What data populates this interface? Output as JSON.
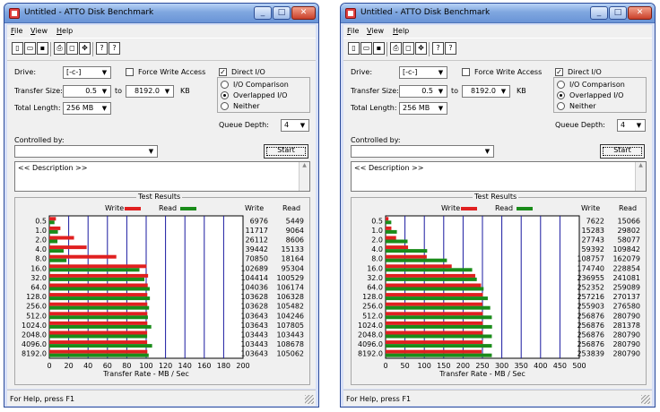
{
  "windows": [
    {
      "title": "Untitled - ATTO Disk Benchmark",
      "menu": [
        "File",
        "View",
        "Help"
      ],
      "labels": {
        "drive": "Drive:",
        "transfer_size": "Transfer Size:",
        "to": "to",
        "kb": "KB",
        "total_length": "Total Length:",
        "force_write_access": "Force Write Access",
        "direct_io": "Direct I/O",
        "io_comparison": "I/O Comparison",
        "overlapped_io": "Overlapped I/O",
        "neither": "Neither",
        "queue_depth": "Queue Depth:",
        "controlled_by": "Controlled by:",
        "start": "Start",
        "test_results": "Test Results",
        "write": "Write",
        "read": "Read",
        "x_axis_title": "Transfer Rate - MB / Sec"
      },
      "values": {
        "drive": "[-c-]",
        "transfer_from": "0.5",
        "transfer_to": "8192.0",
        "total_length": "256 MB",
        "queue_depth": "4",
        "controlled_by": "",
        "description": "<< Description >>",
        "force_write_access": false,
        "direct_io": true,
        "io_mode": "Overlapped I/O"
      },
      "status": "For Help, press F1",
      "chart_data": {
        "type": "bar",
        "categories": [
          "0.5",
          "1.0",
          "2.0",
          "4.0",
          "8.0",
          "16.0",
          "32.0",
          "64.0",
          "128.0",
          "256.0",
          "512.0",
          "1024.0",
          "2048.0",
          "4096.0",
          "8192.0"
        ],
        "series": [
          {
            "name": "Write",
            "color": "#e02020",
            "values": [
              6976,
              11717,
              26112,
              39442,
              70850,
              102689,
              104414,
              104036,
              103628,
              103628,
              103643,
              103643,
              103443,
              103443,
              103643
            ]
          },
          {
            "name": "Read",
            "color": "#1a8c1a",
            "values": [
              5449,
              9064,
              8606,
              15133,
              18164,
              95304,
              100529,
              106174,
              106328,
              105482,
              104246,
              107805,
              103443,
              108678,
              105062
            ]
          }
        ],
        "x_ticks": [
          "0",
          "20",
          "40",
          "60",
          "80",
          "100",
          "120",
          "140",
          "160",
          "180",
          "200"
        ],
        "xlim": [
          0,
          200
        ],
        "xlabel": "Transfer Rate - MB / Sec"
      }
    },
    {
      "title": "Untitled - ATTO Disk Benchmark",
      "menu": [
        "File",
        "View",
        "Help"
      ],
      "labels": {
        "drive": "Drive:",
        "transfer_size": "Transfer Size:",
        "to": "to",
        "kb": "KB",
        "total_length": "Total Length:",
        "force_write_access": "Force Write Access",
        "direct_io": "Direct I/O",
        "io_comparison": "I/O Comparison",
        "overlapped_io": "Overlapped I/O",
        "neither": "Neither",
        "queue_depth": "Queue Depth:",
        "controlled_by": "Controlled by:",
        "start": "Start",
        "test_results": "Test Results",
        "write": "Write",
        "read": "Read",
        "x_axis_title": "Transfer Rate - MB / Sec"
      },
      "values": {
        "drive": "[-c-]",
        "transfer_from": "0.5",
        "transfer_to": "8192.0",
        "total_length": "256 MB",
        "queue_depth": "4",
        "controlled_by": "",
        "description": "<< Description >>",
        "force_write_access": false,
        "direct_io": true,
        "io_mode": "Overlapped I/O"
      },
      "status": "For Help, press F1",
      "chart_data": {
        "type": "bar",
        "categories": [
          "0.5",
          "1.0",
          "2.0",
          "4.0",
          "8.0",
          "16.0",
          "32.0",
          "64.0",
          "128.0",
          "256.0",
          "512.0",
          "1024.0",
          "2048.0",
          "4096.0",
          "8192.0"
        ],
        "series": [
          {
            "name": "Write",
            "color": "#e02020",
            "values": [
              7622,
              15283,
              27743,
              59392,
              108757,
              174740,
              236955,
              252352,
              257216,
              255903,
              256876,
              256876,
              256876,
              256876,
              253839
            ]
          },
          {
            "name": "Read",
            "color": "#1a8c1a",
            "values": [
              15066,
              29802,
              58077,
              109842,
              162079,
              228854,
              241081,
              259089,
              270137,
              276580,
              280790,
              281378,
              280790,
              280790,
              280790
            ]
          }
        ],
        "x_ticks": [
          "0",
          "50",
          "100",
          "150",
          "200",
          "250",
          "300",
          "350",
          "400",
          "450",
          "500"
        ],
        "xlim": [
          0,
          500
        ],
        "xlabel": "Transfer Rate - MB / Sec"
      }
    }
  ]
}
